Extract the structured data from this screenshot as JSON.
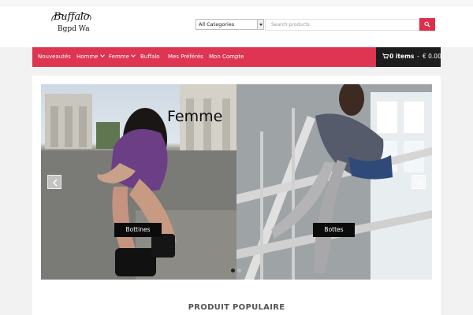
{
  "header": {
    "logo": {
      "script": "Buffalo",
      "subtitle": "Bgpd Wa"
    },
    "search": {
      "category_selected": "All Categories",
      "placeholder": "Search products"
    }
  },
  "nav": {
    "items": [
      {
        "label": "Nouveautés",
        "dropdown": false
      },
      {
        "label": "Homme",
        "dropdown": true
      },
      {
        "label": "Femme",
        "dropdown": true
      },
      {
        "label": "Buffalo",
        "dropdown": false
      },
      {
        "label": "Mes Préférés",
        "dropdown": false
      },
      {
        "label": "Mon Compte",
        "dropdown": false
      }
    ]
  },
  "cart": {
    "count_label": "0 items",
    "separator": "-",
    "total": "€ 0.00",
    "icon": "cart-icon"
  },
  "slider": {
    "title": "Femme",
    "left_button": "Bottines",
    "right_button": "Bottes",
    "dots": 2,
    "active_dot": 0
  },
  "section": {
    "title": "PRODUIT POPULAIRE"
  },
  "colors": {
    "accent": "#dd3552",
    "cart_bg": "#1d1d1d",
    "search_btn": "#dc2f4b"
  },
  "icons": [
    "search-icon",
    "cart-icon",
    "chevron-left-icon",
    "chevron-right-icon"
  ]
}
